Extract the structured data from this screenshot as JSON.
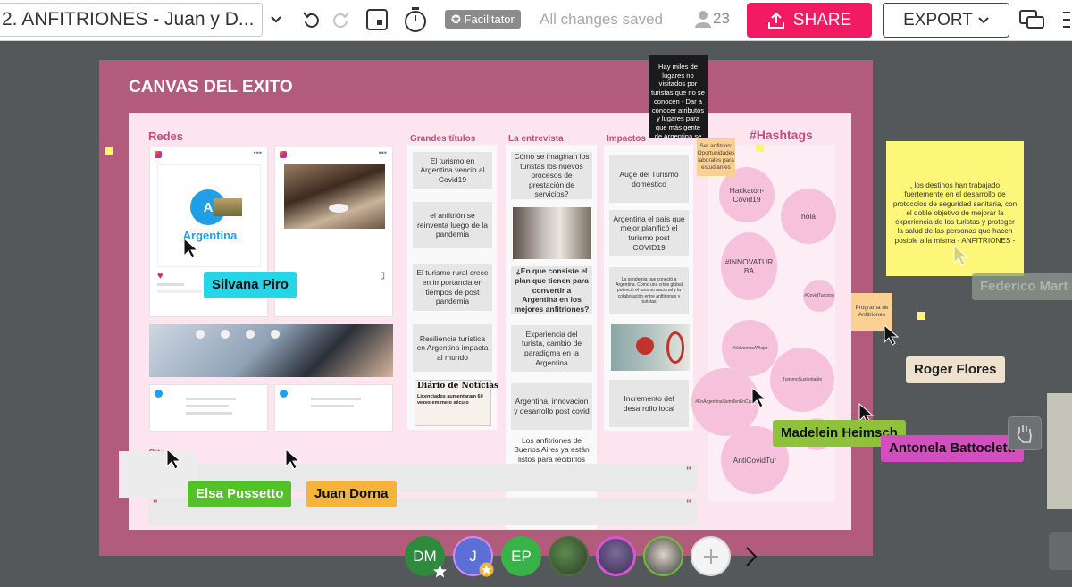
{
  "toolbar": {
    "title": "2. ANFITRIONES - Juan y D...",
    "facilitator_label": "Facilitator",
    "save_status": "All changes saved",
    "user_count": "23",
    "share_label": "SHARE",
    "export_label": "EXPORT",
    "colors": {
      "share": "#f21a63",
      "facilitator_badge": "#8b8b8b"
    }
  },
  "board": {
    "title": "CANVAS DEL EXITO",
    "sections": {
      "redes": "Redes",
      "grandes_titulos": "Grandes títulos",
      "entrevista": "La entrevista",
      "impactos": "Impactos",
      "hashtags": "#Hashtags",
      "citas": "Citas"
    },
    "redes_post": {
      "logo_letter": "A",
      "logo_text": "Argentina"
    },
    "grandes_titulos": [
      "El turismo en Argentina vencio al Covid19",
      "el anfitrión se reinventa luego de la pandemia",
      "El  turismo rural crece en importancia en tiempos de post pandemia",
      "Resiliencia turística en Argentina impacta al mundo"
    ],
    "newspaper": {
      "masthead": "Diário de Notícias",
      "headline": "Licenciados aumentaram 60 vezes em meio século"
    },
    "entrevista": [
      "Cómo se imaginan los turistas los nuevos procesos de prestación de servicios?",
      "¿En que consiste el plan que tienen para convertir  a Argentina en los mejores anfitriones?",
      "Experiencia del turista, cambio de paradigma en la Argentina",
      "Argentina, innovacion y desarrollo post covid",
      "Los anfitriones de Buenos Aires ya están listos para recibirlos"
    ],
    "impactos": [
      "Auge del Turismo doméstico",
      "Argentina el país que mejor planificó el turismo post COVID19",
      "La pandemia que conectó a Argentina. Como una crisis global potenció el turismo nacional y la colaboración entre anfitriones y turistas",
      "Incremento del desarrollo local"
    ],
    "hashtags": [
      "Hackaton-Covid19",
      "hola",
      "#INNOVATUR BA",
      "#CovidTurismo",
      "#VolvemosAViajar",
      "TurismoSustentable",
      "#EnArgentinaSiemTenEnCasa",
      "AntiCovidTur"
    ]
  },
  "notes": {
    "dark": "Hay miles de lugares no visitados por turistas que no se conocen - Dar a conocer atributos y lugares para que más gente de Argentina se anime a viajar por el país",
    "orange_top": "Ser anfitrion: Oportunidades laborales para estudiantes",
    "orange_right": "Programa de Anfitriones",
    "yellow": ", los destinos han trabajado fuertemente en el desarrollo de protocolos de seguridad sanitaria, con el doble objetivo de mejorar la experiencia de los turistas y proteger la salud de las personas que hacen posible a la misma - ANFITRIONES -"
  },
  "collaborators": [
    {
      "name": "Silvana Piro",
      "color": "#25d6e8",
      "text_color": "#111111"
    },
    {
      "name": "Federico Mart",
      "color": "#8e9a8e",
      "text_color": "#c9d1c9"
    },
    {
      "name": "Roger Flores",
      "color": "#efe2cc",
      "text_color": "#222222"
    },
    {
      "name": "Madelein Heimsch",
      "color": "#8fc23b",
      "text_color": "#111111"
    },
    {
      "name": "Antonela Battocletti",
      "color": "#d34fbf",
      "text_color": "#111111"
    },
    {
      "name": "Elsa Pussetto",
      "color": "#55c12a",
      "text_color": "#ffffff"
    },
    {
      "name": "Juan Dorna",
      "color": "#f4b43c",
      "text_color": "#111111"
    }
  ],
  "avatars": [
    {
      "initials": "DM",
      "color": "#2e8a3c",
      "star": true
    },
    {
      "initials": "J",
      "color": "#5b6fd6",
      "star": true
    },
    {
      "initials": "EP",
      "color": "#37b34a",
      "star": false
    }
  ]
}
